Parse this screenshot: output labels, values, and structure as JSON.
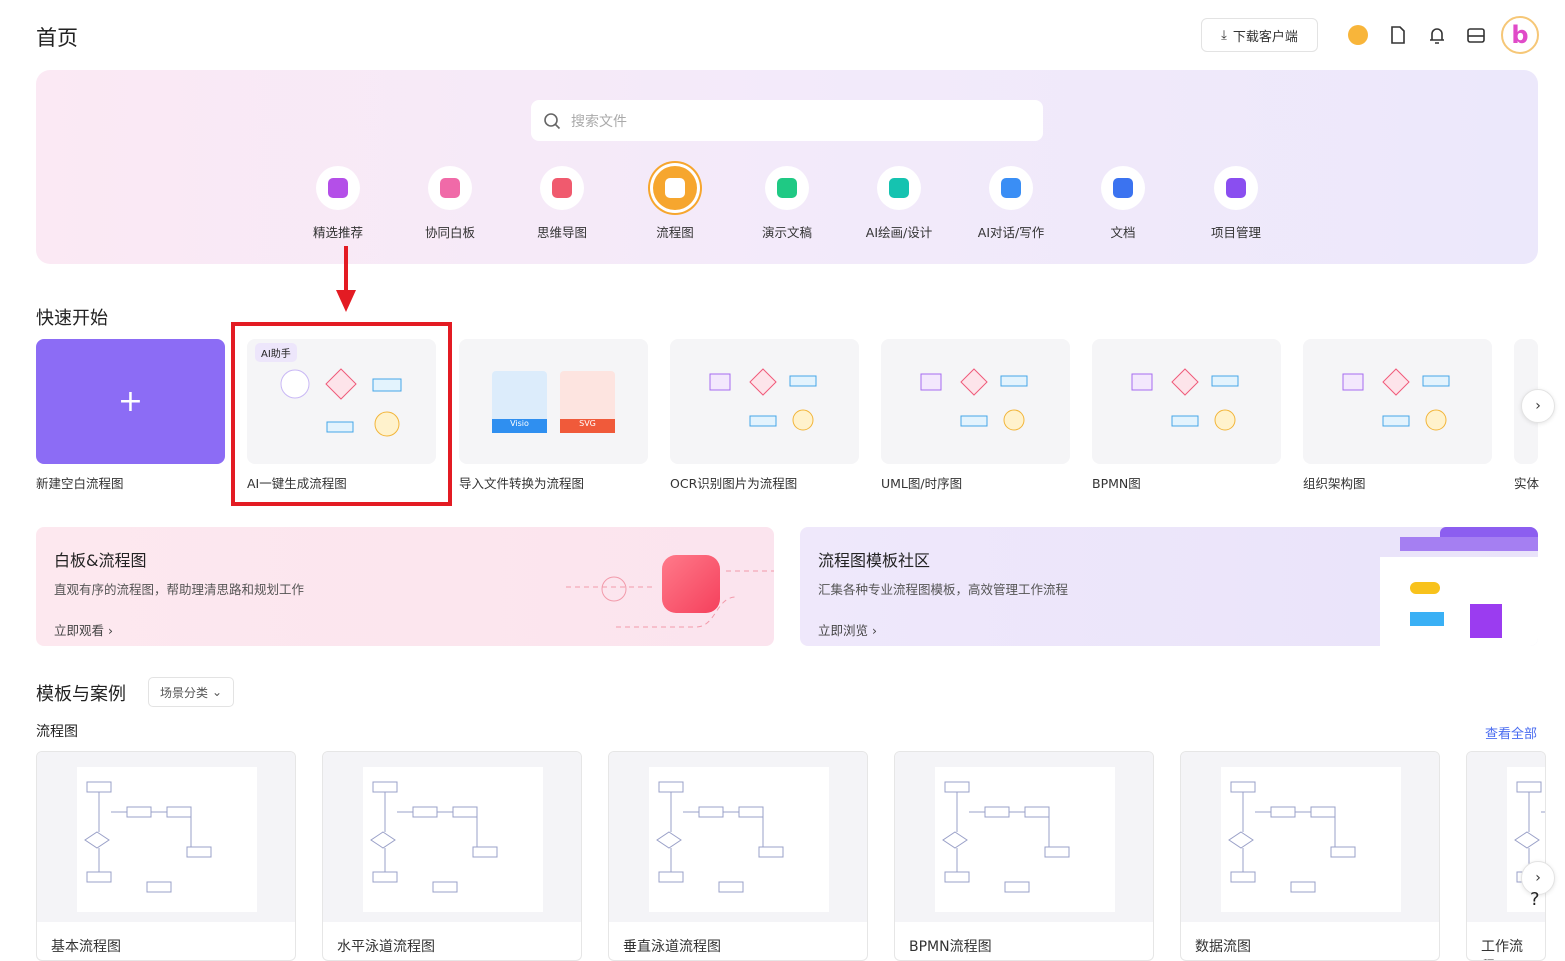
{
  "header": {
    "title": "首页",
    "download_label": "下载客户端"
  },
  "search": {
    "placeholder": "搜索文件"
  },
  "categories": [
    {
      "label": "精选推荐",
      "color": "#b44fe8"
    },
    {
      "label": "协同白板",
      "color": "#f06aa8"
    },
    {
      "label": "思维导图",
      "color": "#f05a6e"
    },
    {
      "label": "流程图",
      "color": "#ffffff"
    },
    {
      "label": "演示文稿",
      "color": "#1fc984"
    },
    {
      "label": "AI绘画/设计",
      "color": "#15c3b0"
    },
    {
      "label": "AI对话/写作",
      "color": "#3a8ef5"
    },
    {
      "label": "文档",
      "color": "#3b73f0"
    },
    {
      "label": "项目管理",
      "color": "#8a4ef0"
    }
  ],
  "quick": {
    "title": "快速开始",
    "ai_badge": "AI助手",
    "items": [
      {
        "label": "新建空白流程图"
      },
      {
        "label": "AI一键生成流程图"
      },
      {
        "label": "导入文件转换为流程图",
        "visio": "Visio",
        "svg": "SVG"
      },
      {
        "label": "OCR识别图片为流程图"
      },
      {
        "label": "UML图/时序图"
      },
      {
        "label": "BPMN图"
      },
      {
        "label": "组织架构图"
      },
      {
        "label": "实体"
      }
    ]
  },
  "promos": [
    {
      "title": "白板&流程图",
      "desc": "直观有序的流程图，帮助理清思路和规划工作",
      "link": "立即观看"
    },
    {
      "title": "流程图模板社区",
      "desc": "汇集各种专业流程图模板，高效管理工作流程",
      "link": "立即浏览"
    }
  ],
  "templates": {
    "title": "模板与案例",
    "filter": "场景分类",
    "subtitle": "流程图",
    "view_all": "查看全部",
    "items": [
      {
        "label": "基本流程图"
      },
      {
        "label": "水平泳道流程图"
      },
      {
        "label": "垂直泳道流程图"
      },
      {
        "label": "BPMN流程图"
      },
      {
        "label": "数据流图"
      },
      {
        "label": "工作流程"
      }
    ]
  },
  "help": "?"
}
